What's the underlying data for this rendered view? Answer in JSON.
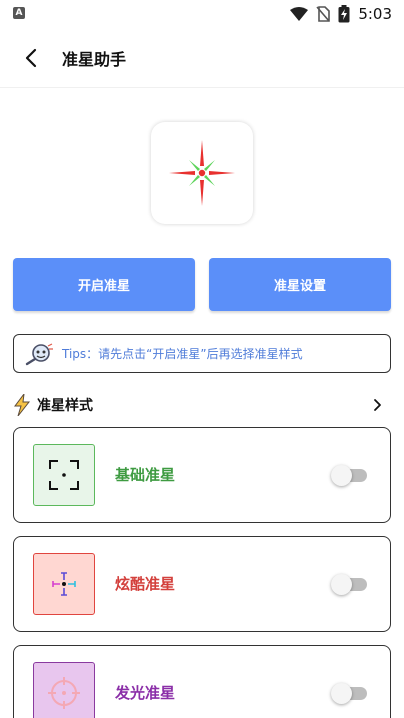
{
  "status_bar": {
    "badge": "A",
    "time": "5:03",
    "icons": [
      "wifi-icon",
      "no-sim-icon",
      "battery-charging-icon"
    ]
  },
  "header": {
    "title": "准星助手",
    "back_icon": "back-arrow-icon"
  },
  "preview": {
    "icon": "crosshair-preview-icon",
    "colors": {
      "red": "#e8312f",
      "green": "#5cd45a"
    }
  },
  "actions": {
    "open_label": "开启准星",
    "settings_label": "准星设置",
    "button_color": "#5b8ff9"
  },
  "tips": {
    "icon": "magnifier-character-icon",
    "text": "Tips：请先点击“开启准星”后再选择准星样式"
  },
  "section": {
    "icon": "lightning-icon",
    "title": "准星样式",
    "arrow_icon": "chevron-right-icon"
  },
  "styles": [
    {
      "label": "基础准星",
      "label_color": "#3e9b41",
      "thumb_bg": "#e8f5e9",
      "thumb_border": "#5cb85c",
      "icon": "basic-crosshair-icon",
      "enabled": false
    },
    {
      "label": "炫酷准星",
      "label_color": "#d3403c",
      "thumb_bg": "#ffd7d2",
      "thumb_border": "#e0453f",
      "icon": "cool-crosshair-icon",
      "enabled": false
    },
    {
      "label": "发光准星",
      "label_color": "#8b2fa8",
      "thumb_bg": "#e8c6ee",
      "thumb_border": "#8a3a9f",
      "icon": "glow-crosshair-icon",
      "enabled": false
    }
  ]
}
